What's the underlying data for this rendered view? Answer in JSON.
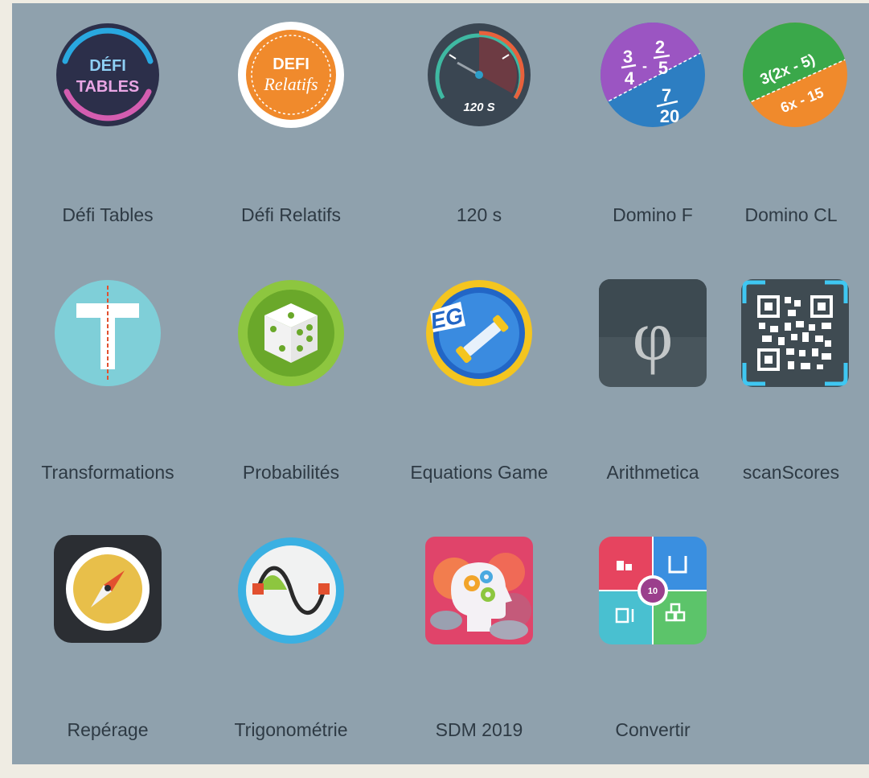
{
  "apps": [
    {
      "name": "Défi Tables",
      "icon": "defi-tables-icon",
      "badge_line1": "DÉFI",
      "badge_line2": "TABLES"
    },
    {
      "name": "Défi Relatifs",
      "icon": "defi-relatifs-icon",
      "badge_line1": "DEFI",
      "badge_line2": "Relatifs"
    },
    {
      "name": "120 s",
      "icon": "speedometer-icon",
      "badge_text": "120 S"
    },
    {
      "name": "Domino F",
      "icon": "domino-fractions-icon",
      "frac_a": "3",
      "frac_b": "4",
      "frac_c": "2",
      "frac_d": "5",
      "frac_e": "7",
      "frac_f": "20"
    },
    {
      "name": "Domino CL",
      "icon": "domino-literal-icon",
      "expr_top": "3(2x - 5)",
      "expr_bottom": "6x - 15"
    },
    {
      "name": "Transformations",
      "icon": "transformations-icon",
      "badge_text": "T"
    },
    {
      "name": "Probabilités",
      "icon": "dice-icon"
    },
    {
      "name": "Equations Game",
      "icon": "equations-game-icon",
      "badge_text": "EG"
    },
    {
      "name": "Arithmetica",
      "icon": "phi-icon",
      "badge_text": "φ"
    },
    {
      "name": "scanScores",
      "icon": "qr-code-icon"
    },
    {
      "name": "Repérage",
      "icon": "compass-icon"
    },
    {
      "name": "Trigonométrie",
      "icon": "sine-wave-icon"
    },
    {
      "name": "SDM 2019",
      "icon": "head-gears-icon"
    },
    {
      "name": "Convertir",
      "icon": "units-converter-icon",
      "badge_text": "10"
    }
  ],
  "colors": {
    "panel": "#8fa1ad",
    "label": "#2e3a44"
  }
}
